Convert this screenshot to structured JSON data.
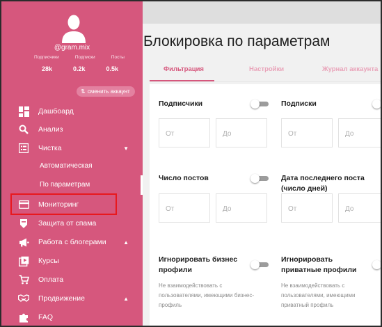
{
  "profile": {
    "username": "@gram.mix",
    "stats": [
      {
        "label": "Подписчики",
        "value": "28k"
      },
      {
        "label": "Подписки",
        "value": "0.2k"
      },
      {
        "label": "Посты",
        "value": "0.5k"
      }
    ],
    "switch_account_label": "сменить аккаунт"
  },
  "sidebar": {
    "items": [
      {
        "label": "Дашбоард",
        "icon": "dashboard-icon"
      },
      {
        "label": "Анализ",
        "icon": "search-icon"
      },
      {
        "label": "Чистка",
        "icon": "list-icon",
        "caret": "▼"
      },
      {
        "label": "Мониторинг",
        "icon": "credit-card-icon"
      },
      {
        "label": "Защита от спама",
        "icon": "shield-icon"
      },
      {
        "label": "Работа с блогерами",
        "icon": "megaphone-icon",
        "caret": "▲"
      },
      {
        "label": "Курсы",
        "icon": "courses-icon"
      },
      {
        "label": "Оплата",
        "icon": "cart-icon"
      },
      {
        "label": "Продвижение",
        "icon": "handshake-icon",
        "caret": "▲"
      },
      {
        "label": "FAQ",
        "icon": "puzzle-icon"
      }
    ],
    "subitems": [
      {
        "label": "Автоматическая"
      },
      {
        "label": "По параметрам"
      }
    ]
  },
  "main": {
    "title": "Блокировка по параметрам",
    "tabs": [
      {
        "label": "Фильтрация"
      },
      {
        "label": "Настройки"
      },
      {
        "label": "Журнал аккаунта"
      }
    ],
    "filters": {
      "followers": {
        "label": "Подписчики",
        "from": "От",
        "to": "До"
      },
      "following": {
        "label": "Подписки",
        "from": "От",
        "to": "До"
      },
      "posts": {
        "label": "Число постов",
        "from": "От",
        "to": "До"
      },
      "last_post": {
        "label_line1": "Дата последнего поста",
        "label_line2": "(число дней)",
        "from": "От",
        "to": "До"
      },
      "ignore_business": {
        "label_line1": "Игнорировать бизнес",
        "label_line2": "профили",
        "desc_line1": "Не взаимодействовать с",
        "desc_line2": "пользователями, имеющими бизнес-",
        "desc_line3": "профиль"
      },
      "ignore_private": {
        "label_line1": "Игнорировать",
        "label_line2": "приватные профили",
        "desc_line1": "Не взаимодействовать с",
        "desc_line2": "пользователями, имеющими",
        "desc_line3": "приватный профиль"
      }
    }
  },
  "colors": {
    "sidebar": "#d6577d",
    "accent": "#d6577d",
    "highlight": "#e8181e"
  }
}
